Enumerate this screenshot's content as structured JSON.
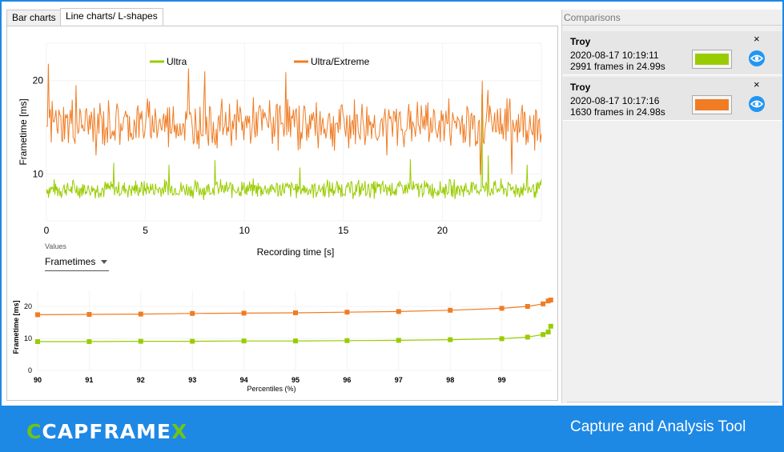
{
  "tabs": [
    {
      "label": "Bar charts",
      "active": false
    },
    {
      "label": "Line charts/ L-shapes",
      "active": true
    }
  ],
  "values_selector": {
    "label": "Values",
    "selected": "Frametimes"
  },
  "comparisons": {
    "header": "Comparisons",
    "items": [
      {
        "title": "Troy",
        "date": "2020-08-17 10:19:11",
        "frames": "2991 frames in 24.99s",
        "color": "#99cc00",
        "close": "×"
      },
      {
        "title": "Troy",
        "date": "2020-08-17 10:17:16",
        "frames": "1630 frames in 24.98s",
        "color": "#f07c24",
        "close": "×"
      }
    ]
  },
  "footer": {
    "logo_main": "CAPFRAME",
    "logo_c": "C",
    "logo_x": "X",
    "tagline": "Capture and Analysis Tool"
  },
  "chart_data": [
    {
      "type": "line",
      "ylabel": "Frametime [ms]",
      "xlabel": "Recording time [s]",
      "xlim": [
        0,
        25
      ],
      "ylim": [
        5,
        24
      ],
      "xticks": [
        0,
        5,
        10,
        15,
        20
      ],
      "yticks": [
        10,
        20
      ],
      "legend_position": "top",
      "series": [
        {
          "name": "Ultra",
          "color": "#99cc00",
          "mean": 8.4,
          "jitter": 1.2,
          "spikes": [
            [
              3.4,
              11.2
            ],
            [
              6.2,
              11.0
            ],
            [
              8.5,
              11.5
            ],
            [
              12.8,
              10.7
            ],
            [
              18.4,
              11.6
            ],
            [
              22.0,
              18.5
            ],
            [
              22.3,
              12.0
            ],
            [
              24.3,
              11.0
            ]
          ]
        },
        {
          "name": "Ultra/Extreme",
          "color": "#f07c24",
          "mean": 15.4,
          "jitter": 3.2,
          "spikes": [
            [
              0.1,
              21.8
            ],
            [
              1.5,
              19.5
            ],
            [
              2.5,
              12.0
            ],
            [
              7.2,
              21.3
            ],
            [
              8.0,
              21.0
            ],
            [
              12.1,
              20.9
            ],
            [
              17.2,
              12.0
            ],
            [
              22.0,
              20.0
            ],
            [
              22.3,
              19.0
            ],
            [
              21.9,
              9.9
            ],
            [
              23.5,
              10.0
            ]
          ]
        }
      ]
    },
    {
      "type": "line",
      "ylabel": "Frametime [ms]",
      "xlabel": "Percentiles (%)",
      "x_tick_labels": [
        "90",
        "91",
        "92",
        "93",
        "94",
        "95",
        "96",
        "97",
        "98",
        "99"
      ],
      "xlim": [
        90,
        100
      ],
      "ylim": [
        0,
        25
      ],
      "yticks": [
        0,
        10,
        20
      ],
      "x": [
        90,
        91,
        92,
        93,
        94,
        95,
        96,
        97,
        98,
        99,
        99.5,
        99.8,
        99.9,
        99.95
      ],
      "series": [
        {
          "name": "Ultra/Extreme",
          "color": "#f07c24",
          "values": [
            17.4,
            17.5,
            17.6,
            17.8,
            17.9,
            18.0,
            18.2,
            18.4,
            18.8,
            19.4,
            20.0,
            20.8,
            21.7,
            22.0
          ]
        },
        {
          "name": "Ultra",
          "color": "#99cc00",
          "values": [
            9.0,
            9.0,
            9.1,
            9.1,
            9.2,
            9.2,
            9.3,
            9.4,
            9.6,
            9.9,
            10.4,
            11.2,
            12.0,
            13.8
          ]
        }
      ]
    }
  ]
}
